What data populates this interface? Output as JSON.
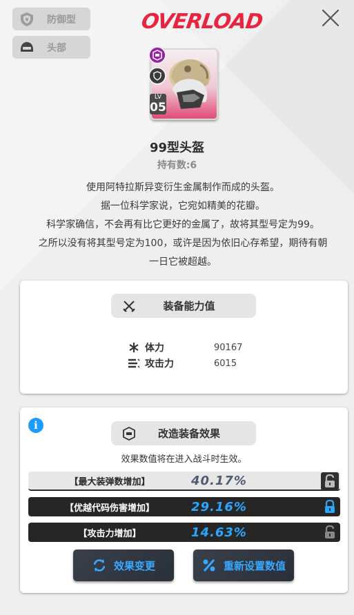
{
  "filters": {
    "type_label": "防御型",
    "slot_label": "头部"
  },
  "header": {
    "logo_text": "OVERLOAD"
  },
  "item": {
    "level_prefix": "LV",
    "level": "05",
    "name": "99型头盔",
    "owned_label": "持有数:6",
    "description": [
      "使用阿特拉斯异变衍生金属制作而成的头盔。",
      "据一位科学家说，它宛如精美的花瓣。",
      "科学家确信，不会再有比它更好的金属了，故将其型号定为99。",
      "之所以没有将其型号定为100，或许是因为依旧心存希望，期待有朝",
      "一日它被超越。"
    ]
  },
  "stats_panel": {
    "title": "装备能力值",
    "stats": [
      {
        "icon": "asterisk-icon",
        "name": "体力",
        "value": "90167"
      },
      {
        "icon": "bars-icon",
        "name": "攻击力",
        "value": "6015"
      }
    ]
  },
  "overload_panel": {
    "title": "改造装备效果",
    "note": "效果数值将在进入战斗时生效。",
    "effects": [
      {
        "name": "【最大装弹数增加】",
        "value": "40.17%",
        "locked": false,
        "style": "light"
      },
      {
        "name": "【优越代码伤害增加】",
        "value": "29.16%",
        "locked": true,
        "style": "dark"
      },
      {
        "name": "【攻击力增加】",
        "value": "14.63%",
        "locked": false,
        "style": "dark"
      }
    ],
    "buttons": {
      "change_label": "效果变更",
      "reset_label": "重新设置数值"
    }
  },
  "colors": {
    "logo": "#e8243f",
    "accent_blue": "#2ba6ff",
    "card_pink": "#e04c77"
  }
}
